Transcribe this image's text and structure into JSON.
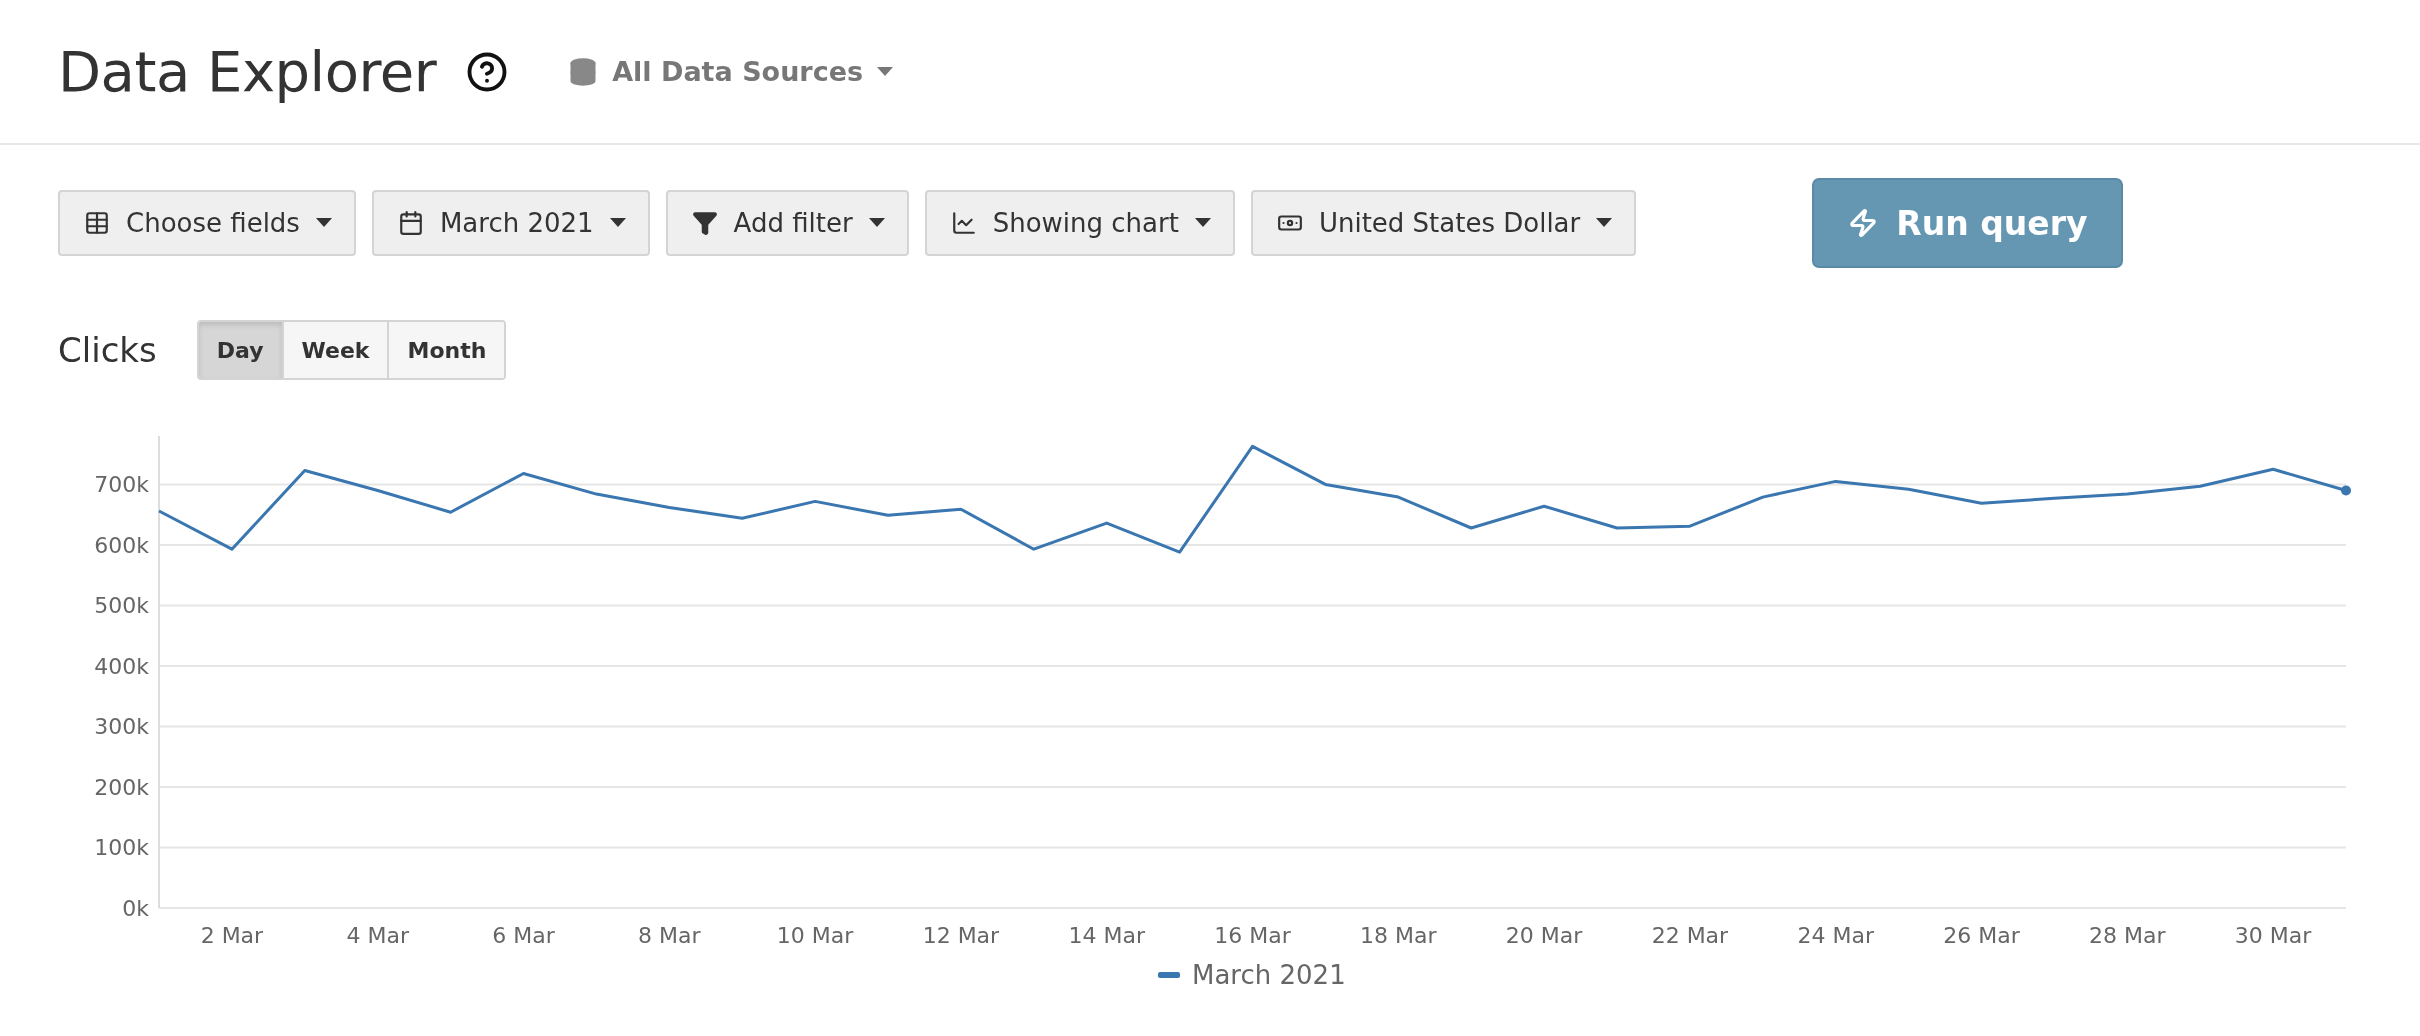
{
  "header": {
    "title": "Data Explorer",
    "data_source": {
      "label": "All Data Sources"
    }
  },
  "toolbar": {
    "dropdowns": [
      {
        "kind": "fields",
        "label": "Choose fields"
      },
      {
        "kind": "date",
        "label": "March 2021"
      },
      {
        "kind": "filter",
        "label": "Add filter"
      },
      {
        "kind": "chart",
        "label": "Showing chart"
      },
      {
        "kind": "currency",
        "label": "United States Dollar"
      }
    ],
    "run_button": {
      "label": "Run query"
    }
  },
  "metric": {
    "title": "Clicks",
    "periods": [
      {
        "label": "Day",
        "selected": true
      },
      {
        "label": "Week",
        "selected": false
      },
      {
        "label": "Month",
        "selected": false
      }
    ],
    "chart_data": {
      "type": "line",
      "categories": [
        null,
        "2 Mar",
        null,
        "4 Mar",
        null,
        "6 Mar",
        null,
        "8 Mar",
        null,
        "10 Mar",
        null,
        "12 Mar",
        null,
        "14 Mar",
        null,
        "16 Mar",
        null,
        "18 Mar",
        null,
        "20 Mar",
        null,
        "22 Mar",
        null,
        "24 Mar",
        null,
        "26 Mar",
        null,
        "28 Mar",
        null,
        "30 Mar",
        null
      ],
      "series": [
        {
          "name": "March 2021",
          "color": "#3a76b0",
          "values": [
            656000,
            593000,
            723000,
            690000,
            654000,
            718000,
            684000,
            662000,
            644000,
            672000,
            649000,
            659000,
            593000,
            636000,
            588000,
            763000,
            700000,
            679000,
            628000,
            664000,
            628000,
            631000,
            679000,
            705000,
            692000,
            669000,
            677000,
            684000,
            697000,
            725000,
            690000
          ]
        }
      ],
      "grid": true,
      "ylim": [
        0,
        780000
      ],
      "yticks": [
        {
          "value": 0,
          "label": "0k"
        },
        {
          "value": 100000,
          "label": "100k"
        },
        {
          "value": 200000,
          "label": "200k"
        },
        {
          "value": 300000,
          "label": "300k"
        },
        {
          "value": 400000,
          "label": "400k"
        },
        {
          "value": 500000,
          "label": "500k"
        },
        {
          "value": 600000,
          "label": "600k"
        },
        {
          "value": 700000,
          "label": "700k"
        }
      ]
    }
  }
}
